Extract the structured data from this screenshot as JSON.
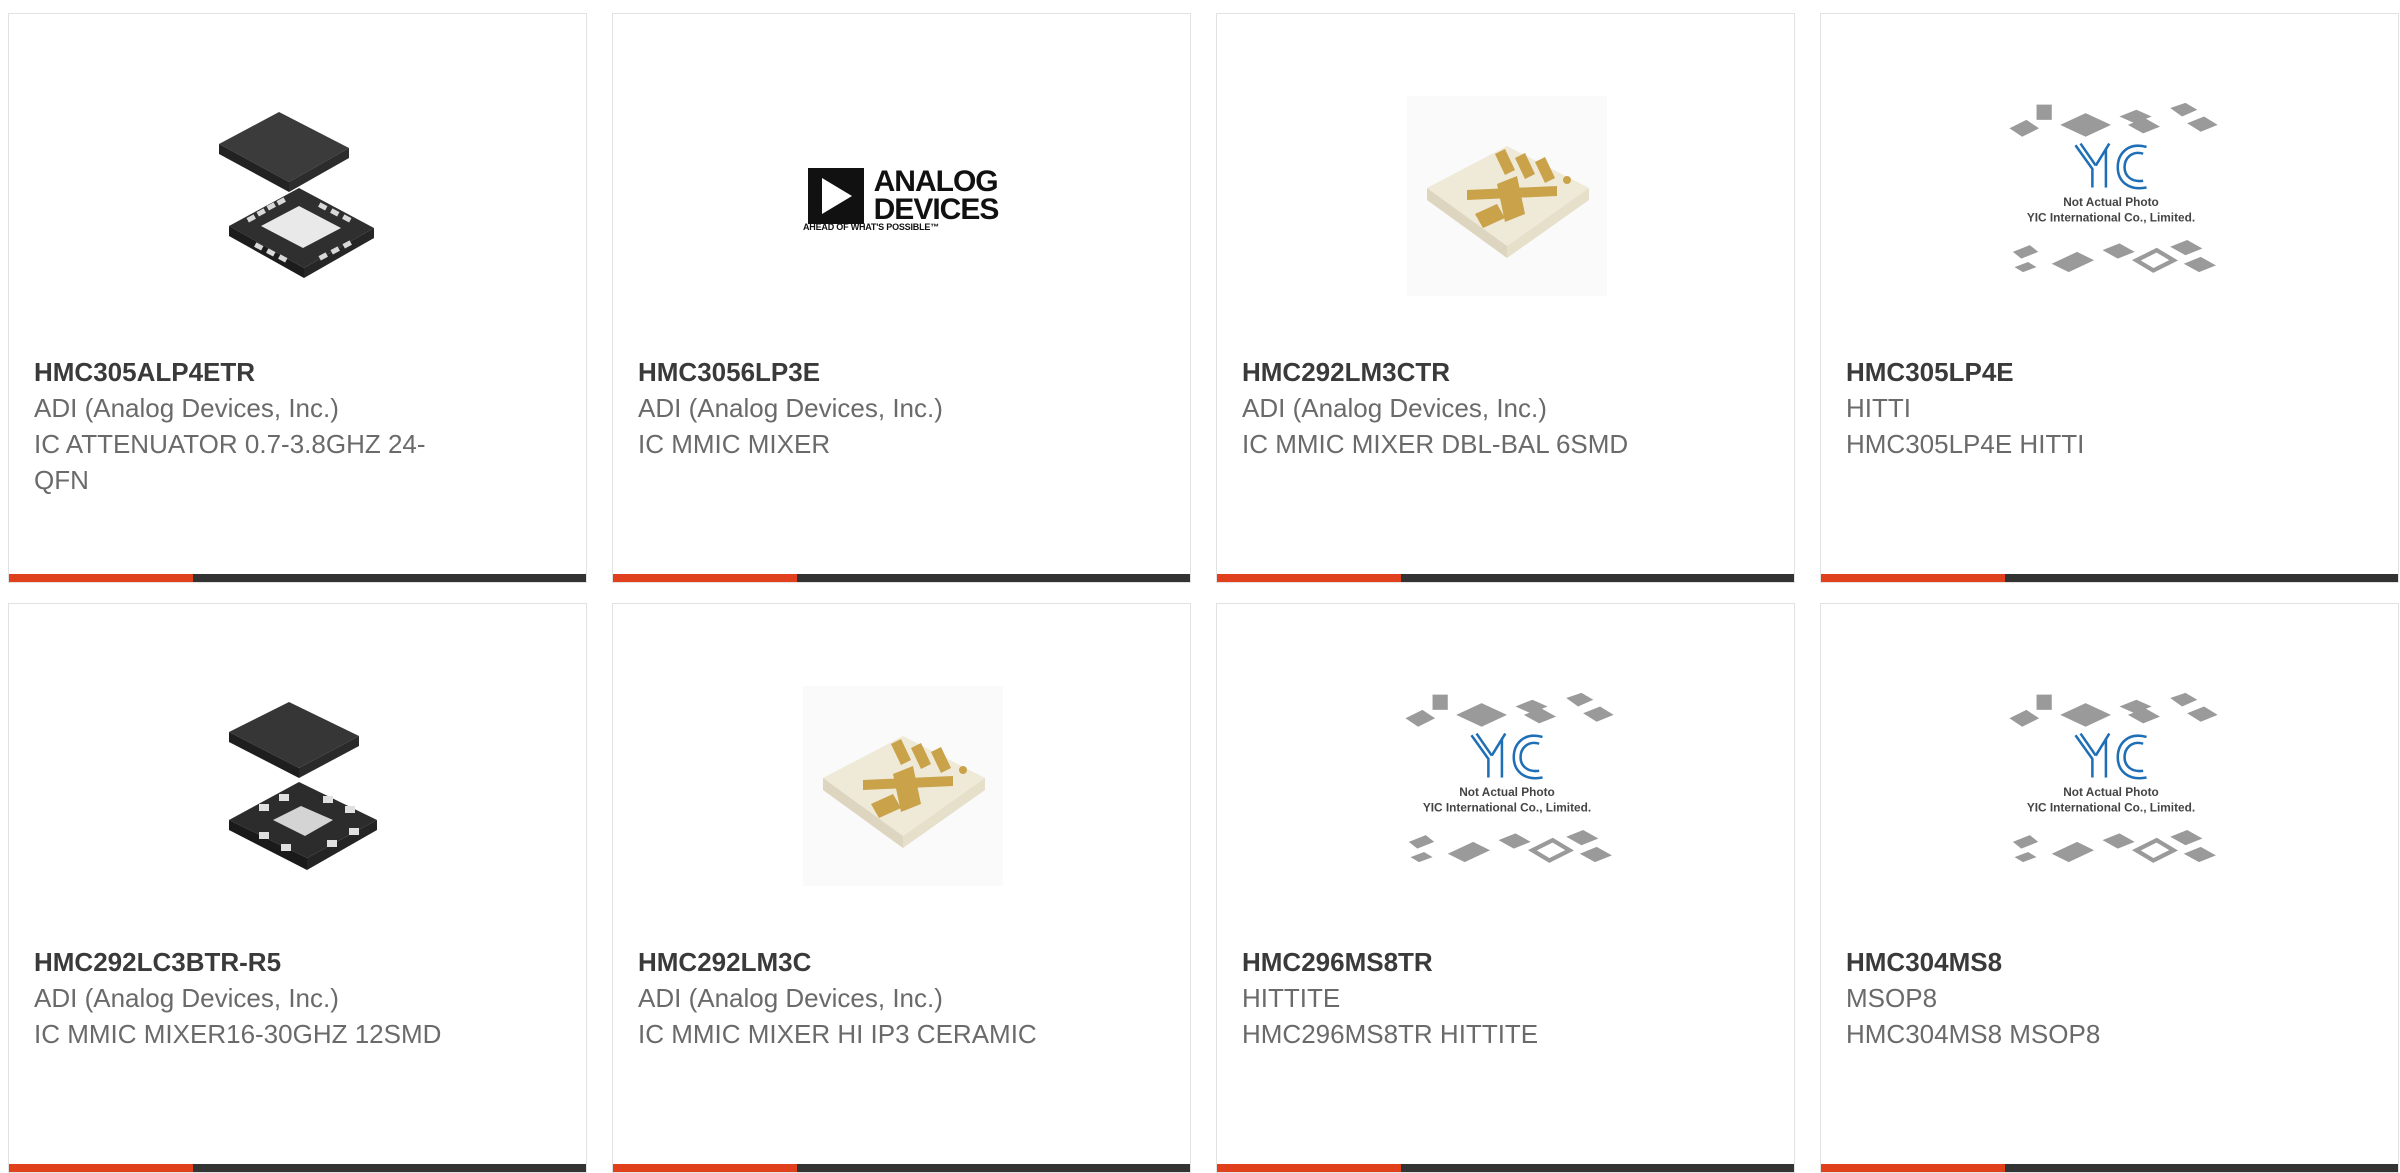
{
  "products": [
    {
      "part_number": "HMC305ALP4ETR",
      "manufacturer": "ADI (Analog Devices, Inc.)",
      "description": "IC ATTENUATOR 0.7-3.8GHZ 24-QFN",
      "image": "qfn-24-chip-icon"
    },
    {
      "part_number": "HMC3056LP3E",
      "manufacturer": "ADI (Analog Devices, Inc.)",
      "description": "IC MMIC MIXER",
      "image": "analog-devices-logo"
    },
    {
      "part_number": "HMC292LM3CTR",
      "manufacturer": "ADI (Analog Devices, Inc.)",
      "description": "IC MMIC MIXER DBL-BAL 6SMD",
      "image": "ceramic-smd-chip-icon"
    },
    {
      "part_number": "HMC305LP4E",
      "manufacturer": "HITTI",
      "description": "HMC305LP4E HITTI",
      "image": "yic-placeholder-icon"
    },
    {
      "part_number": "HMC292LC3BTR-R5",
      "manufacturer": "ADI (Analog Devices, Inc.)",
      "description": "IC MMIC MIXER16-30GHZ 12SMD",
      "image": "qfn-12-chip-icon"
    },
    {
      "part_number": "HMC292LM3C",
      "manufacturer": "ADI (Analog Devices, Inc.)",
      "description": "IC MMIC MIXER HI IP3 CERAMIC",
      "image": "ceramic-smd-chip-icon"
    },
    {
      "part_number": "HMC296MS8TR",
      "manufacturer": "HITTITE",
      "description": "HMC296MS8TR HITTITE",
      "image": "yic-placeholder-icon"
    },
    {
      "part_number": "HMC304MS8",
      "manufacturer": "MSOP8",
      "description": "HMC304MS8 MSOP8",
      "image": "yic-placeholder-icon"
    }
  ],
  "logo_text": {
    "adi_line1": "ANALOG",
    "adi_line2": "DEVICES",
    "adi_tagline": "AHEAD OF WHAT'S POSSIBLE™",
    "yic_mark": "YIC",
    "yic_caption_1": "Not Actual Photo",
    "yic_caption_2": "YIC International Co., Limited."
  },
  "colors": {
    "accent": "#e0401c",
    "bar": "#333333",
    "part_number_text": "#3a3a3a",
    "body_text": "#6a6a6a",
    "card_border": "#e2e2e2"
  }
}
